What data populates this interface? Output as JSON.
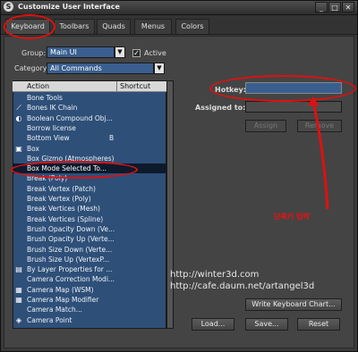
{
  "window": {
    "title": "Customize User Interface",
    "app_icon": "max-logo-icon",
    "controls": [
      "_",
      "□",
      "✕"
    ]
  },
  "tabs": [
    {
      "label": "Keyboard",
      "active": true
    },
    {
      "label": "Toolbars"
    },
    {
      "label": "Quads"
    },
    {
      "label": "Menus"
    },
    {
      "label": "Colors"
    }
  ],
  "group": {
    "label": "Group:",
    "value": "Main UI",
    "active_label": "Active",
    "active_checked": true
  },
  "category": {
    "label": "Category:",
    "value": "All Commands"
  },
  "list": {
    "columns": [
      "Action",
      "Shortcut"
    ],
    "rows": [
      {
        "icon": "",
        "label": "Bone Tools",
        "shortcut": ""
      },
      {
        "icon": "bones-icon",
        "label": "Bones IK Chain",
        "shortcut": ""
      },
      {
        "icon": "boolean-icon",
        "label": "Boolean Compound Obj...",
        "shortcut": ""
      },
      {
        "icon": "",
        "label": "Borrow license",
        "shortcut": ""
      },
      {
        "icon": "",
        "label": "Bottom View",
        "shortcut": "B"
      },
      {
        "icon": "box-icon",
        "label": "Box",
        "shortcut": ""
      },
      {
        "icon": "",
        "label": "Box Gizmo (Atmospheres)",
        "shortcut": ""
      },
      {
        "icon": "",
        "label": "Box Mode Selected To...",
        "shortcut": "",
        "selected": true
      },
      {
        "icon": "",
        "label": "Break (Poly)",
        "shortcut": ""
      },
      {
        "icon": "",
        "label": "Break Vertex (Patch)",
        "shortcut": ""
      },
      {
        "icon": "",
        "label": "Break Vertex (Poly)",
        "shortcut": ""
      },
      {
        "icon": "",
        "label": "Break Vertices (Mesh)",
        "shortcut": ""
      },
      {
        "icon": "",
        "label": "Break Vertices (Spline)",
        "shortcut": ""
      },
      {
        "icon": "",
        "label": "Brush Opacity Down (Ve...",
        "shortcut": ""
      },
      {
        "icon": "",
        "label": "Brush Opacity Up (Verte...",
        "shortcut": ""
      },
      {
        "icon": "",
        "label": "Brush Size Down (Verte...",
        "shortcut": ""
      },
      {
        "icon": "",
        "label": "Brush Size Up (VertexP...",
        "shortcut": ""
      },
      {
        "icon": "layer-icon",
        "label": "By Layer Properties for ...",
        "shortcut": ""
      },
      {
        "icon": "",
        "label": "Camera Correction Modi...",
        "shortcut": ""
      },
      {
        "icon": "camera-map-icon",
        "label": "Camera Map (WSM)",
        "shortcut": ""
      },
      {
        "icon": "camera-map-icon",
        "label": "Camera Map Modifier",
        "shortcut": ""
      },
      {
        "icon": "",
        "label": "Camera Match...",
        "shortcut": ""
      },
      {
        "icon": "camera-point-icon",
        "label": "Camera Point",
        "shortcut": ""
      }
    ]
  },
  "hotkey": {
    "label": "Hotkey:",
    "value": ""
  },
  "assigned": {
    "label": "Assigned to:",
    "value": ""
  },
  "buttons": {
    "assign": "Assign",
    "remove": "Remove",
    "write_chart": "Write Keyboard Chart...",
    "load": "Load...",
    "save": "Save...",
    "reset": "Reset"
  },
  "watermark": {
    "line1": "http://winter3d.com",
    "line2": "http://cafe.daum.net/artangel3d"
  },
  "annotation": {
    "text": "단축키 입력",
    "color": "#e01010"
  },
  "colors": {
    "list_bg": "#2e4f78",
    "accent": "#3a5f8f",
    "annotation": "#e01010"
  }
}
